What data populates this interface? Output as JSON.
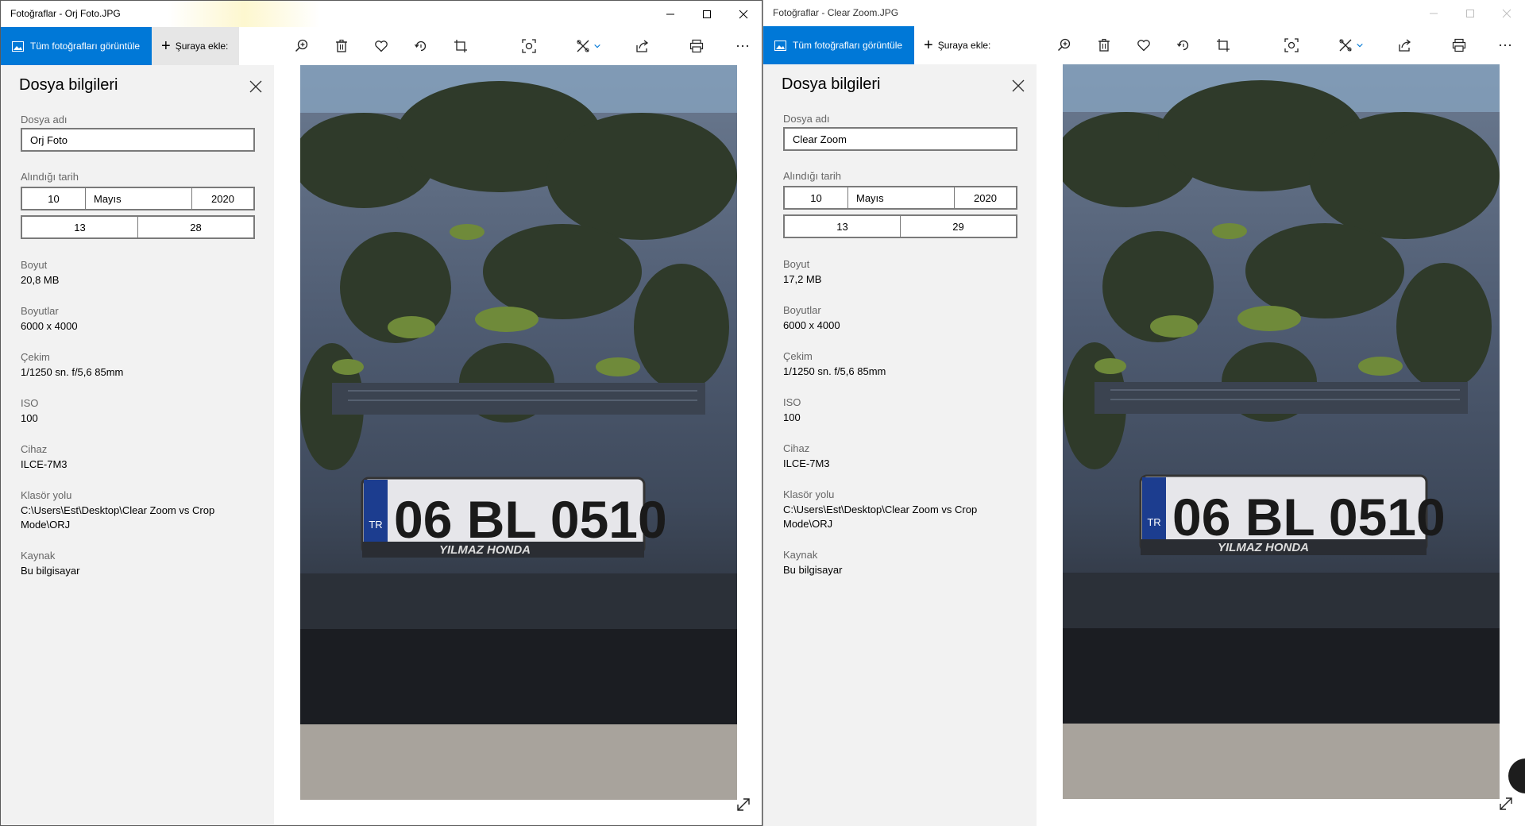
{
  "windows": [
    {
      "title": "Fotoğraflar - Orj Foto.JPG",
      "toolbar": {
        "view_all_label": "Tüm fotoğrafları görüntüle",
        "add_to_label": "Şuraya ekle:"
      },
      "panel": {
        "heading": "Dosya bilgileri",
        "filename_label": "Dosya adı",
        "filename_value": "Orj Foto",
        "date_label": "Alındığı tarih",
        "day": "10",
        "month": "Mayıs",
        "year": "2020",
        "hour": "13",
        "minute": "28",
        "size_label": "Boyut",
        "size_value": "20,8 MB",
        "dimensions_label": "Boyutlar",
        "dimensions_value": "6000 x 4000",
        "shot_label": "Çekim",
        "shot_value": "1/1250 sn. f/5,6 85mm",
        "iso_label": "ISO",
        "iso_value": "100",
        "device_label": "Cihaz",
        "device_value": "ILCE-7M3",
        "folder_label": "Klasör yolu",
        "folder_line1": "C:\\Users\\Est\\Desktop\\Clear Zoom vs Crop",
        "folder_line2": "Mode\\ORJ",
        "source_label": "Kaynak",
        "source_value": "Bu bilgisayar"
      },
      "photo": {
        "plate_text": "06 BL 0510",
        "dealer_text": "YILMAZ HONDA",
        "country_code": "TR"
      }
    },
    {
      "title": "Fotoğraflar - Clear Zoom.JPG",
      "toolbar": {
        "view_all_label": "Tüm fotoğrafları görüntüle",
        "add_to_label": "Şuraya ekle:"
      },
      "panel": {
        "heading": "Dosya bilgileri",
        "filename_label": "Dosya adı",
        "filename_value": "Clear Zoom",
        "date_label": "Alındığı tarih",
        "day": "10",
        "month": "Mayıs",
        "year": "2020",
        "hour": "13",
        "minute": "29",
        "size_label": "Boyut",
        "size_value": "17,2 MB",
        "dimensions_label": "Boyutlar",
        "dimensions_value": "6000 x 4000",
        "shot_label": "Çekim",
        "shot_value": "1/1250 sn. f/5,6 85mm",
        "iso_label": "ISO",
        "iso_value": "100",
        "device_label": "Cihaz",
        "device_value": "ILCE-7M3",
        "folder_label": "Klasör yolu",
        "folder_line1": "C:\\Users\\Est\\Desktop\\Clear Zoom vs Crop",
        "folder_line2": "Mode\\ORJ",
        "source_label": "Kaynak",
        "source_value": "Bu bilgisayar"
      },
      "photo": {
        "plate_text": "06 BL 0510",
        "dealer_text": "YILMAZ HONDA",
        "country_code": "TR"
      }
    }
  ],
  "colors": {
    "accent": "#0078d7",
    "panel_bg": "#f2f2f2",
    "add_button_bg": "#e6e6e6"
  },
  "icons": [
    "picture-icon",
    "plus-icon",
    "zoom-icon",
    "delete-icon",
    "heart-icon",
    "rotate-icon",
    "crop-icon",
    "enhance-icon",
    "edit-icon",
    "chevron-down-icon",
    "share-icon",
    "print-icon",
    "more-icon",
    "close-icon",
    "minimize-icon",
    "maximize-icon",
    "expand-icon"
  ]
}
